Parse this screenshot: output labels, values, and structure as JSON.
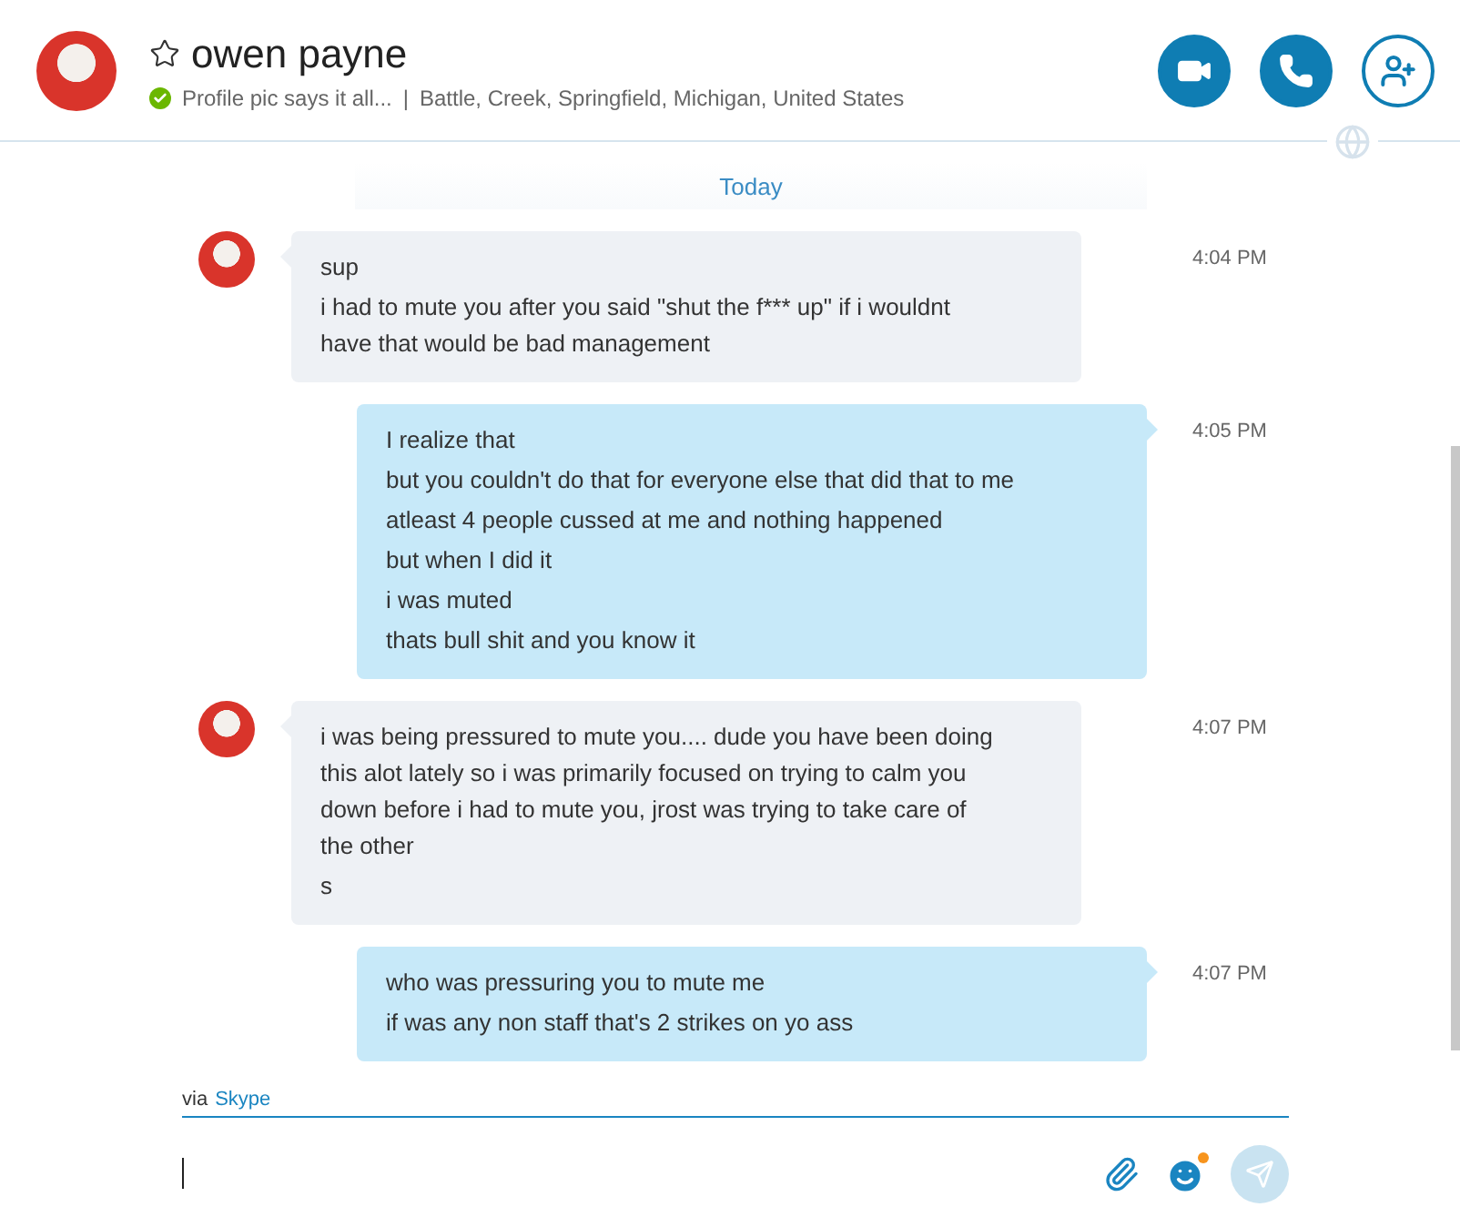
{
  "contact": {
    "name": "owen payne",
    "favorite": false,
    "online": true,
    "mood": "Profile pic says it all...",
    "separator": "|",
    "location": "Battle, Creek, Springfield, Michigan, United States"
  },
  "header_actions": [
    {
      "kind": "video"
    },
    {
      "kind": "call"
    },
    {
      "kind": "add-person"
    }
  ],
  "date_divider": "Today",
  "messages": [
    {
      "kind": "incoming",
      "time": "4:04 PM",
      "paragraphs": [
        [
          "sup"
        ],
        [
          "i had to mute you after you said \"shut the f*** up\" if i wouldnt",
          "have that would be bad management"
        ]
      ]
    },
    {
      "kind": "outgoing",
      "time": "4:05 PM",
      "paragraphs": [
        [
          "I realize that"
        ],
        [
          "but you couldn't do that for everyone else that did that to me"
        ],
        [
          "atleast 4 people cussed at me and nothing happened"
        ],
        [
          "but when I did it"
        ],
        [
          "i was muted"
        ],
        [
          "thats bull shit and you know it"
        ]
      ]
    },
    {
      "kind": "incoming",
      "time": "4:07 PM",
      "paragraphs": [
        [
          "i was being pressured to mute you.... dude you have been doing",
          "this alot lately so i was primarily focused on trying to calm you",
          "down before i had to mute you, jrost was trying to take care of",
          "the other"
        ],
        [
          "s"
        ]
      ]
    },
    {
      "kind": "outgoing",
      "time": "4:07 PM",
      "paragraphs": [
        [
          "who was pressuring you to mute me"
        ],
        [
          "if was any non staff that's 2 strikes on yo ass"
        ]
      ]
    }
  ],
  "compose": {
    "via": "via",
    "service": "Skype",
    "send_enabled": false
  }
}
